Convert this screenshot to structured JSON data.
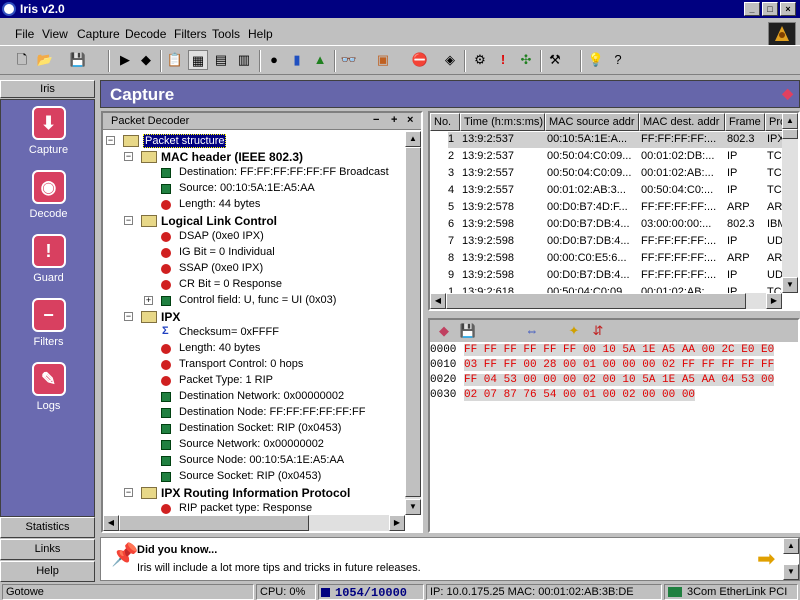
{
  "window": {
    "title": "Iris v2.0",
    "controls": [
      "_",
      "□",
      "×"
    ]
  },
  "menu": [
    "File",
    "View",
    "Capture",
    "Decode",
    "Filters",
    "Tools",
    "Help"
  ],
  "toolbar": {
    "icons": [
      "new-icon",
      "open-icon",
      "save-icon",
      "play-icon",
      "stop-capture-icon",
      "copy-icon",
      "view1-icon",
      "view2-icon",
      "view3-icon",
      "pie-icon",
      "bar-icon",
      "chart-icon",
      "binoculars-icon",
      "box-icon",
      "stop-icon",
      "eraser-icon",
      "gear-icon",
      "alert-icon",
      "network-icon",
      "tools-icon",
      "tip-icon",
      "help-icon"
    ]
  },
  "sidebar": {
    "header": "Iris",
    "items": [
      {
        "label": "Capture",
        "icon": "capture-icon"
      },
      {
        "label": "Decode",
        "icon": "decode-icon"
      },
      {
        "label": "Guard",
        "icon": "guard-icon"
      },
      {
        "label": "Filters",
        "icon": "filters-icon"
      },
      {
        "label": "Logs",
        "icon": "logs-icon"
      }
    ],
    "bottom": [
      "Statistics",
      "Links",
      "Help"
    ]
  },
  "capture": {
    "title": "Capture"
  },
  "decoder": {
    "title": "Packet Decoder",
    "controls": [
      "−",
      "+",
      "×"
    ],
    "tree": [
      {
        "t": "Packet structure",
        "lvl": 0,
        "k": "folder",
        "sel": true
      },
      {
        "t": "MAC header (IEEE 802.3)",
        "lvl": 1,
        "k": "folder",
        "bold": true
      },
      {
        "t": "Destination: FF:FF:FF:FF:FF:FF  Broadcast",
        "lvl": 2,
        "k": "g"
      },
      {
        "t": "Source: 00:10:5A:1E:A5:AA",
        "lvl": 2,
        "k": "g"
      },
      {
        "t": "Length: 44 bytes",
        "lvl": 2,
        "k": "i"
      },
      {
        "t": "Logical Link Control",
        "lvl": 1,
        "k": "folder",
        "bold": true
      },
      {
        "t": "DSAP (0xe0 IPX)",
        "lvl": 2,
        "k": "i"
      },
      {
        "t": "IG Bit = 0 Individual",
        "lvl": 2,
        "k": "i"
      },
      {
        "t": "SSAP (0xe0 IPX)",
        "lvl": 2,
        "k": "i"
      },
      {
        "t": "CR Bit = 0 Response",
        "lvl": 2,
        "k": "i"
      },
      {
        "t": "Control field: U, func = UI (0x03)",
        "lvl": 2,
        "k": "g",
        "plus": true
      },
      {
        "t": "IPX",
        "lvl": 1,
        "k": "folder",
        "bold": true
      },
      {
        "t": "Checksum= 0xFFFF",
        "lvl": 2,
        "k": "sum"
      },
      {
        "t": "Length: 40 bytes",
        "lvl": 2,
        "k": "i"
      },
      {
        "t": "Transport Control: 0 hops",
        "lvl": 2,
        "k": "i"
      },
      {
        "t": "Packet Type: 1 RIP",
        "lvl": 2,
        "k": "i"
      },
      {
        "t": "Destination Network: 0x00000002",
        "lvl": 2,
        "k": "g"
      },
      {
        "t": "Destination Node: FF:FF:FF:FF:FF:FF",
        "lvl": 2,
        "k": "g"
      },
      {
        "t": "Destination Socket: RIP (0x0453)",
        "lvl": 2,
        "k": "g"
      },
      {
        "t": "Source Network: 0x00000002",
        "lvl": 2,
        "k": "g"
      },
      {
        "t": "Source Node: 00:10:5A:1E:A5:AA",
        "lvl": 2,
        "k": "g"
      },
      {
        "t": "Source Socket: RIP (0x0453)",
        "lvl": 2,
        "k": "g"
      },
      {
        "t": "IPX Routing Information Protocol",
        "lvl": 1,
        "k": "folder",
        "bold": true
      },
      {
        "t": "RIP packet type: Response",
        "lvl": 2,
        "k": "i"
      }
    ]
  },
  "packets": {
    "columns": [
      "No.",
      "Time (h:m:s:ms)",
      "MAC source addr",
      "MAC dest. addr",
      "Frame",
      "Pro"
    ],
    "rows": [
      [
        "1",
        "13:9:2:537",
        "00:10:5A:1E:A...",
        "FF:FF:FF:FF:...",
        "802.3",
        "IPX"
      ],
      [
        "2",
        "13:9:2:537",
        "00:50:04:C0:09...",
        "00:01:02:DB:...",
        "IP",
        "TC"
      ],
      [
        "3",
        "13:9:2:557",
        "00:50:04:C0:09...",
        "00:01:02:AB:...",
        "IP",
        "TC"
      ],
      [
        "4",
        "13:9:2:557",
        "00:01:02:AB:3...",
        "00:50:04:C0:...",
        "IP",
        "TC"
      ],
      [
        "5",
        "13:9:2:578",
        "00:D0:B7:4D:F...",
        "FF:FF:FF:FF:...",
        "ARP",
        "AR"
      ],
      [
        "6",
        "13:9:2:598",
        "00:D0:B7:DB:4...",
        "03:00:00:00:...",
        "802.3",
        "IBM"
      ],
      [
        "7",
        "13:9:2:598",
        "00:D0:B7:DB:4...",
        "FF:FF:FF:FF:...",
        "IP",
        "UD"
      ],
      [
        "8",
        "13:9:2:598",
        "00:00:C0:E5:6...",
        "FF:FF:FF:FF:...",
        "ARP",
        "AR"
      ],
      [
        "9",
        "13:9:2:598",
        "00:D0:B7:DB:4...",
        "FF:FF:FF:FF:...",
        "IP",
        "UD"
      ],
      [
        "1",
        "13:9:2:618",
        "00:50:04:C0:09...",
        "00:01:02:AB:...",
        "IP",
        "TC"
      ]
    ]
  },
  "hex": {
    "icons": [
      "save-hex-icon",
      "floppy-icon",
      "width-icon",
      "highlight-icon",
      "split-icon"
    ],
    "rows": [
      {
        "off": "0000",
        "bytes": "FF FF FF FF FF FF 00 10 5A 1E A5 AA 00 2C E0 E0"
      },
      {
        "off": "0010",
        "bytes": "03 FF FF 00 28 00 01 00 00 00 02 FF FF FF FF FF"
      },
      {
        "off": "0020",
        "bytes": "FF 04 53 00 00 00 02 00 10 5A 1E A5 AA 04 53 00"
      },
      {
        "off": "0030",
        "bytes": "02 07 87 76 54 00 01 00 02 00 00 00"
      }
    ]
  },
  "tip": {
    "title": "Did you know...",
    "text": "Iris will include a lot more tips and tricks in future releases."
  },
  "status": {
    "ready": "Gotowe",
    "cpu": "CPU: 0%",
    "buffer": "1054/10000",
    "ip": "IP: 10.0.175.25 MAC: 00:01:02:AB:3B:DE",
    "adapter": "3Com EtherLink PCI"
  }
}
